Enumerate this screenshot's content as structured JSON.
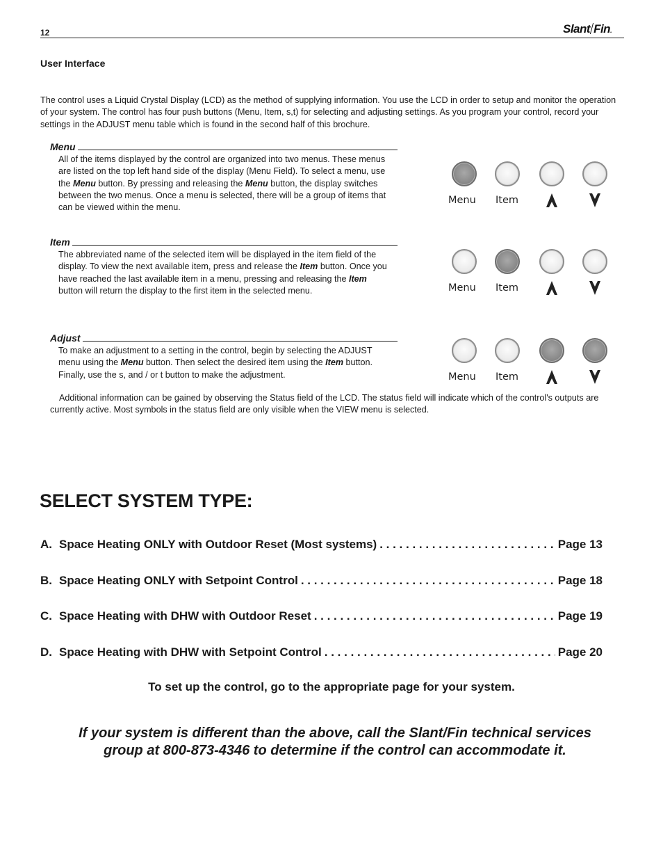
{
  "header": {
    "page_number": "12",
    "logo_left": "Slant",
    "logo_right": "Fin",
    "logo_mark": "."
  },
  "section_title": "User Interface",
  "intro": "The control uses a Liquid Crystal Display (LCD) as the method of supplying information. You use the LCD in order to setup and monitor the operation of your system. The control has four push buttons (Menu, Item, s,t) for selecting and adjusting settings. As you program your control, record your settings in the ADJUST menu table which is found in the second half of this brochure.",
  "subsections": [
    {
      "heading": "Menu",
      "parts": [
        {
          "t": "All of the items displayed by the control are organized into two menus. These menus are listed on the top left hand side of the display (Menu Field). To select a menu, use the "
        },
        {
          "b": "Menu"
        },
        {
          "t": " button. By pressing and releasing the "
        },
        {
          "b": "Menu"
        },
        {
          "t": " button, the display switches between the two menus. Once a menu is selected, there will be a group of items that can be viewed within the menu."
        }
      ],
      "pressed": [
        "menu"
      ]
    },
    {
      "heading": "Item",
      "parts": [
        {
          "t": "The abbreviated name of the selected item will be displayed in the item field of the display. To view the next available item, press and release the "
        },
        {
          "b": "Item"
        },
        {
          "t": " button. Once you have reached the last available item in a menu, pressing and releasing the "
        },
        {
          "b": "Item"
        },
        {
          "t": " button will return the display to the first item in the selected menu."
        }
      ],
      "pressed": [
        "item"
      ]
    },
    {
      "heading": "Adjust",
      "parts": [
        {
          "t": "To make an adjustment to a setting in the control, begin by selecting the ADJUST menu using the "
        },
        {
          "b": "Menu"
        },
        {
          "t": " button. Then select the desired item using the "
        },
        {
          "b": "Item"
        },
        {
          "t": " button. Finally, use the s, and / or t button to make the adjustment."
        }
      ],
      "pressed": [
        "up",
        "down"
      ]
    }
  ],
  "button_labels": {
    "menu": "Menu",
    "item": "Item",
    "up_icon": "up-arrow-icon",
    "down_icon": "down-arrow-icon"
  },
  "additional_info": "Additional information can be gained by observing the Status field of the LCD. The status field will indicate which of the control's outputs are currently active. Most symbols in the status field are only visible when the VIEW menu is selected.",
  "select_system": {
    "title": "SELECT SYSTEM TYPE:",
    "options": [
      {
        "letter": "A.",
        "label": "Space Heating ONLY with Outdoor Reset (Most systems)",
        "page": "Page 13"
      },
      {
        "letter": "B.",
        "label": "Space Heating ONLY with Setpoint Control",
        "page": "Page 18"
      },
      {
        "letter": "C.",
        "label": "Space Heating with DHW with Outdoor Reset",
        "page": "Page 19"
      },
      {
        "letter": "D.",
        "label": "Space Heating with DHW with Setpoint Control",
        "page": "Page 20"
      }
    ]
  },
  "instruction": "To set up the control, go to the appropriate page for your system.",
  "callout_line1": "If your system is different than the above, call the Slant/Fin technical services",
  "callout_line2": "group at 800-873-4346 to determine if the control can accommodate it."
}
